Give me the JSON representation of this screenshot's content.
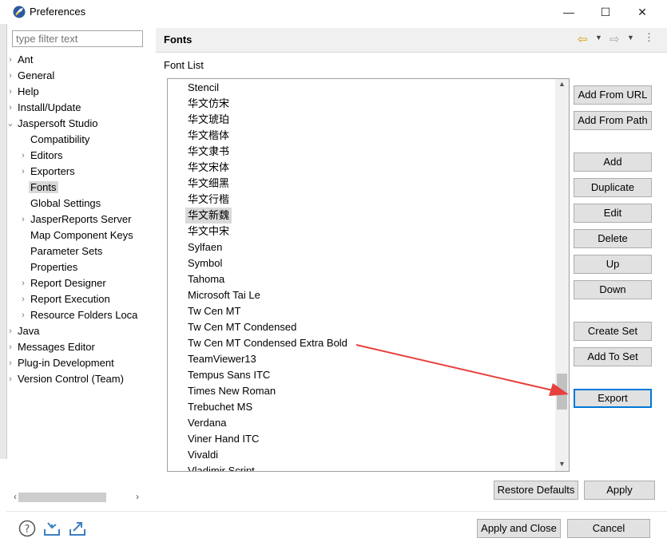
{
  "window": {
    "title": "Preferences",
    "minimize_glyph": "—",
    "maximize_glyph": "☐",
    "close_glyph": "✕"
  },
  "sidebar": {
    "filter_placeholder": "type filter text",
    "items": [
      {
        "label": "Ant",
        "expandable": true,
        "expanded": false,
        "level": 0
      },
      {
        "label": "General",
        "expandable": true,
        "expanded": false,
        "level": 0
      },
      {
        "label": "Help",
        "expandable": true,
        "expanded": false,
        "level": 0
      },
      {
        "label": "Install/Update",
        "expandable": true,
        "expanded": false,
        "level": 0
      },
      {
        "label": "Jaspersoft Studio",
        "expandable": true,
        "expanded": true,
        "level": 0
      },
      {
        "label": "Compatibility",
        "expandable": false,
        "level": 1
      },
      {
        "label": "Editors",
        "expandable": true,
        "expanded": false,
        "level": 1
      },
      {
        "label": "Exporters",
        "expandable": true,
        "expanded": false,
        "level": 1
      },
      {
        "label": "Fonts",
        "expandable": false,
        "level": 1,
        "selected": true
      },
      {
        "label": "Global Settings",
        "expandable": false,
        "level": 1
      },
      {
        "label": "JasperReports Server",
        "expandable": true,
        "expanded": false,
        "level": 1
      },
      {
        "label": "Map Component Keys",
        "expandable": false,
        "level": 1
      },
      {
        "label": "Parameter Sets",
        "expandable": false,
        "level": 1
      },
      {
        "label": "Properties",
        "expandable": false,
        "level": 1
      },
      {
        "label": "Report Designer",
        "expandable": true,
        "expanded": false,
        "level": 1
      },
      {
        "label": "Report Execution",
        "expandable": true,
        "expanded": false,
        "level": 1
      },
      {
        "label": "Resource Folders Loca",
        "expandable": true,
        "expanded": false,
        "level": 1
      },
      {
        "label": "Java",
        "expandable": true,
        "expanded": false,
        "level": 0
      },
      {
        "label": "Messages Editor",
        "expandable": true,
        "expanded": false,
        "level": 0
      },
      {
        "label": "Plug-in Development",
        "expandable": true,
        "expanded": false,
        "level": 0
      },
      {
        "label": "Version Control (Team)",
        "expandable": true,
        "expanded": false,
        "level": 0
      }
    ],
    "scroll_left": "‹",
    "scroll_right": "›"
  },
  "main": {
    "section_title": "Fonts",
    "font_list_label": "Font List",
    "fonts": [
      {
        "name": "Stencil"
      },
      {
        "name": "华文仿宋"
      },
      {
        "name": "华文琥珀"
      },
      {
        "name": "华文楷体"
      },
      {
        "name": "华文隶书"
      },
      {
        "name": "华文宋体"
      },
      {
        "name": "华文细黑"
      },
      {
        "name": "华文行楷"
      },
      {
        "name": "华文新魏",
        "selected": true
      },
      {
        "name": "华文中宋"
      },
      {
        "name": "Sylfaen"
      },
      {
        "name": "Symbol"
      },
      {
        "name": "Tahoma"
      },
      {
        "name": "Microsoft Tai Le"
      },
      {
        "name": "Tw Cen MT"
      },
      {
        "name": "Tw Cen MT Condensed"
      },
      {
        "name": "Tw Cen MT Condensed Extra Bold"
      },
      {
        "name": "TeamViewer13"
      },
      {
        "name": "Tempus Sans ITC"
      },
      {
        "name": "Times New Roman"
      },
      {
        "name": "Trebuchet MS"
      },
      {
        "name": "Verdana"
      },
      {
        "name": "Viner Hand ITC"
      },
      {
        "name": "Vivaldi"
      },
      {
        "name": "Vladimir Script"
      }
    ],
    "buttons": {
      "add_from_url": "Add From URL",
      "add_from_path": "Add From Path",
      "add": "Add",
      "duplicate": "Duplicate",
      "edit": "Edit",
      "delete": "Delete",
      "up": "Up",
      "down": "Down",
      "create_set": "Create Set",
      "add_to_set": "Add To Set",
      "export": "Export"
    },
    "restore_defaults": "Restore Defaults",
    "apply": "Apply"
  },
  "toolbar": {
    "back_glyph": "⇦",
    "forward_glyph": "⇨",
    "dropdown_glyph": "▼",
    "menu_glyph": "⋮"
  },
  "footer": {
    "apply_and_close": "Apply and Close",
    "cancel": "Cancel"
  },
  "colors": {
    "annotation_arrow": "#e8403c",
    "focus_border": "#0078d7",
    "selection_bg": "#d9d9d9"
  }
}
